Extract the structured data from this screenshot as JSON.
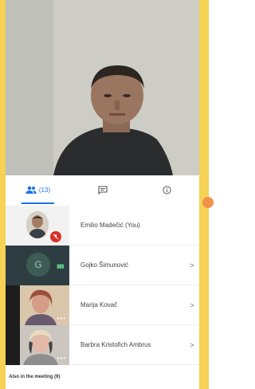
{
  "tabs": {
    "people_count": "(13)"
  },
  "participants": [
    {
      "name": "Emilio Madečić (You)"
    },
    {
      "name": "Gojko Šimunović",
      "initial": "G"
    },
    {
      "name": "Marija Kovač"
    },
    {
      "name": "Barbra Kristofich Ambrus"
    }
  ],
  "also_in_meeting": "Also in the meeting (9)",
  "colors": {
    "accent": "#1a73e8",
    "mute_red": "#d93025",
    "edge_yellow": "#f6d255",
    "orange_dot": "#f0924a"
  },
  "icons": [
    "people-icon",
    "chat-icon",
    "info-icon",
    "mic-off-icon",
    "chevron-right-icon",
    "audio-level-icon",
    "more-dots-icon"
  ]
}
